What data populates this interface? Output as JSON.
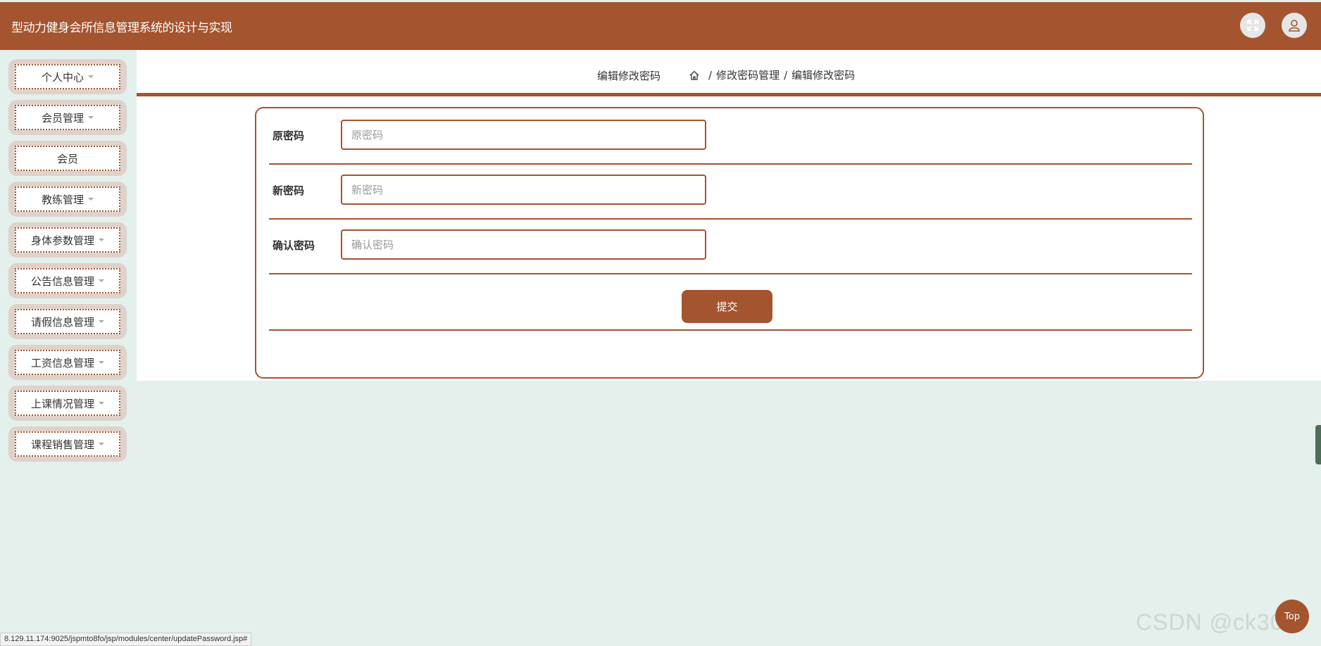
{
  "app": {
    "title": "型动力健身会所信息管理系统的设计与实现"
  },
  "header_icons": {
    "fullscreen": "fullscreen-icon",
    "user": "user-icon"
  },
  "sidebar": {
    "items": [
      {
        "label": "个人中心",
        "has_caret": true
      },
      {
        "label": "会员管理",
        "has_caret": true
      },
      {
        "label": "会员",
        "has_caret": false
      },
      {
        "label": "教练管理",
        "has_caret": true
      },
      {
        "label": "身体参数管理",
        "has_caret": true
      },
      {
        "label": "公告信息管理",
        "has_caret": true
      },
      {
        "label": "请假信息管理",
        "has_caret": true
      },
      {
        "label": "工资信息管理",
        "has_caret": true
      },
      {
        "label": "上课情况管理",
        "has_caret": true
      },
      {
        "label": "课程销售管理",
        "has_caret": true
      }
    ]
  },
  "page": {
    "title": "编辑修改密码",
    "breadcrumb": [
      "修改密码管理",
      "编辑修改密码"
    ],
    "breadcrumb_sep": "/"
  },
  "form": {
    "fields": [
      {
        "label": "原密码",
        "placeholder": "原密码",
        "value": ""
      },
      {
        "label": "新密码",
        "placeholder": "新密码",
        "value": ""
      },
      {
        "label": "确认密码",
        "placeholder": "确认密码",
        "value": ""
      }
    ],
    "submit_label": "提交"
  },
  "status_bar": {
    "url": "8.129.11.174:9025/jspmto8fo/jsp/modules/center/updatePassword.jsp#"
  },
  "watermark": "CSDN @ck3017",
  "back_to_top": "Top",
  "colors": {
    "accent": "#a4542f",
    "background": "#e3f0eb"
  }
}
